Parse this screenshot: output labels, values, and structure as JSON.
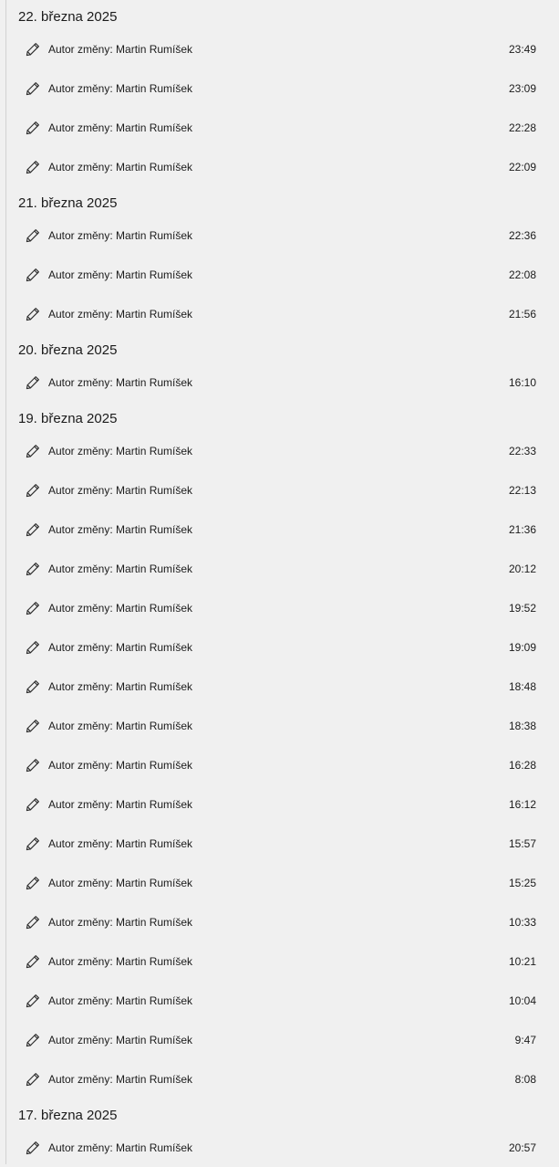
{
  "icon": "pencil-edit-icon",
  "colors": {
    "background": "#f0f0f0",
    "text": "#1b1b1b",
    "rule": "#d2d2d2"
  },
  "groups": [
    {
      "date": "22. března 2025",
      "entries": [
        {
          "label": "Autor změny: Martin Rumíšek",
          "time": "23:49"
        },
        {
          "label": "Autor změny: Martin Rumíšek",
          "time": "23:09"
        },
        {
          "label": "Autor změny: Martin Rumíšek",
          "time": "22:28"
        },
        {
          "label": "Autor změny: Martin Rumíšek",
          "time": "22:09"
        }
      ]
    },
    {
      "date": "21. března 2025",
      "entries": [
        {
          "label": "Autor změny: Martin Rumíšek",
          "time": "22:36"
        },
        {
          "label": "Autor změny: Martin Rumíšek",
          "time": "22:08"
        },
        {
          "label": "Autor změny: Martin Rumíšek",
          "time": "21:56"
        }
      ]
    },
    {
      "date": "20. března 2025",
      "entries": [
        {
          "label": "Autor změny: Martin Rumíšek",
          "time": "16:10"
        }
      ]
    },
    {
      "date": "19. března 2025",
      "entries": [
        {
          "label": "Autor změny: Martin Rumíšek",
          "time": "22:33"
        },
        {
          "label": "Autor změny: Martin Rumíšek",
          "time": "22:13"
        },
        {
          "label": "Autor změny: Martin Rumíšek",
          "time": "21:36"
        },
        {
          "label": "Autor změny: Martin Rumíšek",
          "time": "20:12"
        },
        {
          "label": "Autor změny: Martin Rumíšek",
          "time": "19:52"
        },
        {
          "label": "Autor změny: Martin Rumíšek",
          "time": "19:09"
        },
        {
          "label": "Autor změny: Martin Rumíšek",
          "time": "18:48"
        },
        {
          "label": "Autor změny: Martin Rumíšek",
          "time": "18:38"
        },
        {
          "label": "Autor změny: Martin Rumíšek",
          "time": "16:28"
        },
        {
          "label": "Autor změny: Martin Rumíšek",
          "time": "16:12"
        },
        {
          "label": "Autor změny: Martin Rumíšek",
          "time": "15:57"
        },
        {
          "label": "Autor změny: Martin Rumíšek",
          "time": "15:25"
        },
        {
          "label": "Autor změny: Martin Rumíšek",
          "time": "10:33"
        },
        {
          "label": "Autor změny: Martin Rumíšek",
          "time": "10:21"
        },
        {
          "label": "Autor změny: Martin Rumíšek",
          "time": "10:04"
        },
        {
          "label": "Autor změny: Martin Rumíšek",
          "time": "9:47"
        },
        {
          "label": "Autor změny: Martin Rumíšek",
          "time": "8:08"
        }
      ]
    },
    {
      "date": "17. března 2025",
      "entries": [
        {
          "label": "Autor změny: Martin Rumíšek",
          "time": "20:57"
        }
      ]
    }
  ]
}
